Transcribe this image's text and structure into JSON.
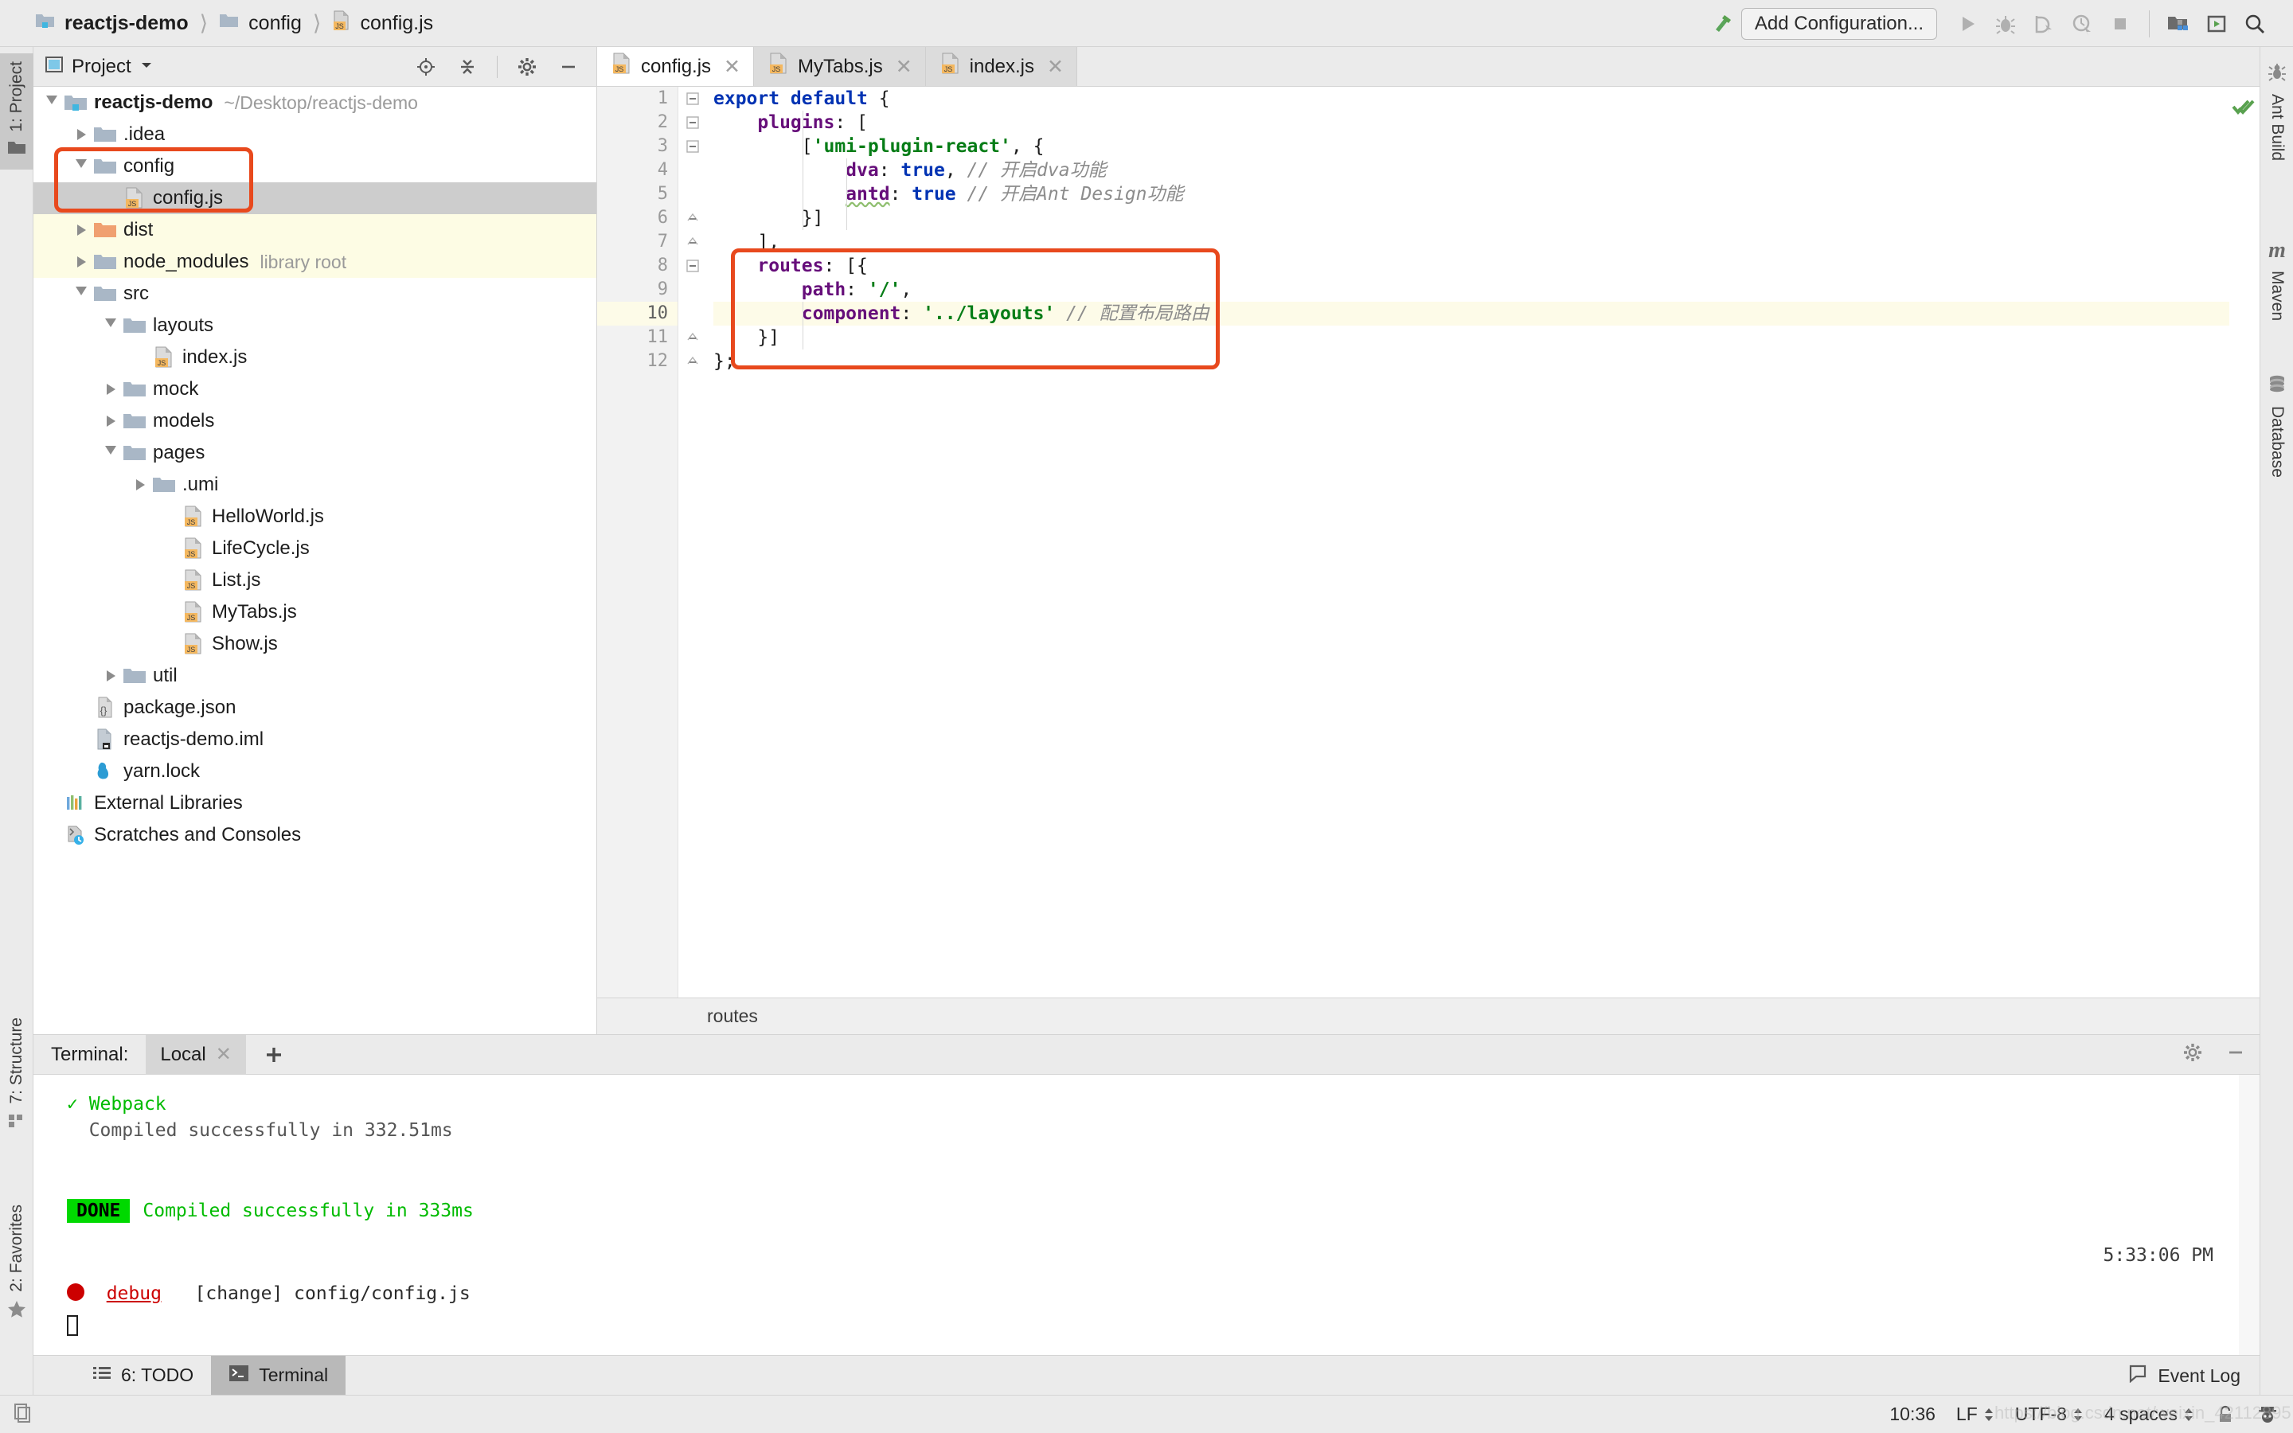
{
  "app": {
    "accent": "#e8491d",
    "breadcrumb": [
      {
        "label": "reactjs-demo",
        "icon": "module-folder-icon"
      },
      {
        "label": "config",
        "icon": "folder-icon"
      },
      {
        "label": "config.js",
        "icon": "js-file-icon"
      }
    ]
  },
  "toolbar": {
    "build_icon": "build-hammer-icon",
    "run_config": "Add Configuration...",
    "run_icon": "run-icon",
    "debug_icon": "debug-bug-icon",
    "coverage_icon": "run-with-coverage-icon",
    "profile_icon": "profiler-icon",
    "stop_icon": "stop-icon",
    "structure_icon": "project-structure-icon",
    "updates_icon": "run-anything-icon",
    "search_icon": "search-everywhere-icon"
  },
  "left_strip": [
    {
      "label": "1: Project",
      "icon": "project-folder-icon",
      "active": true
    },
    {
      "label": "7: Structure",
      "icon": "structure-squares-icon",
      "active": false
    },
    {
      "label": "2: Favorites",
      "icon": "favorites-star-icon",
      "active": false
    }
  ],
  "right_strip": [
    {
      "label": "Ant Build",
      "icon": "ant-icon"
    },
    {
      "label": "Maven",
      "icon": "maven-m-icon"
    },
    {
      "label": "Database",
      "icon": "database-cylinder-icon"
    }
  ],
  "project_panel": {
    "title": "Project",
    "dropdown_icon": "chevron-down-icon",
    "locate_icon": "scroll-from-source-icon",
    "collapse_icon": "collapse-all-icon",
    "settings_icon": "gear-icon",
    "hide_icon": "hide-icon",
    "tree": [
      {
        "label": "reactjs-demo",
        "sub": "~/Desktop/reactjs-demo",
        "depth": 0,
        "twist": "open",
        "icon": "module-folder-icon",
        "bold": true,
        "state": "normal"
      },
      {
        "label": ".idea",
        "sub": "",
        "depth": 1,
        "twist": "closed",
        "icon": "folder-icon",
        "bold": false,
        "state": "normal"
      },
      {
        "label": "config",
        "sub": "",
        "depth": 1,
        "twist": "open",
        "icon": "folder-icon",
        "bold": false,
        "state": "normal"
      },
      {
        "label": "config.js",
        "sub": "",
        "depth": 2,
        "twist": "none",
        "icon": "js-file-icon",
        "bold": false,
        "state": "selected"
      },
      {
        "label": "dist",
        "sub": "",
        "depth": 1,
        "twist": "closed",
        "icon": "excluded-folder-icon",
        "bold": false,
        "state": "yellow"
      },
      {
        "label": "node_modules",
        "sub": "library root",
        "depth": 1,
        "twist": "closed",
        "icon": "folder-icon",
        "bold": false,
        "state": "yellow"
      },
      {
        "label": "src",
        "sub": "",
        "depth": 1,
        "twist": "open",
        "icon": "folder-icon",
        "bold": false,
        "state": "normal"
      },
      {
        "label": "layouts",
        "sub": "",
        "depth": 2,
        "twist": "open",
        "icon": "folder-icon",
        "bold": false,
        "state": "normal"
      },
      {
        "label": "index.js",
        "sub": "",
        "depth": 3,
        "twist": "none",
        "icon": "js-file-icon",
        "bold": false,
        "state": "normal"
      },
      {
        "label": "mock",
        "sub": "",
        "depth": 2,
        "twist": "closed",
        "icon": "folder-icon",
        "bold": false,
        "state": "normal"
      },
      {
        "label": "models",
        "sub": "",
        "depth": 2,
        "twist": "closed",
        "icon": "folder-icon",
        "bold": false,
        "state": "normal"
      },
      {
        "label": "pages",
        "sub": "",
        "depth": 2,
        "twist": "open",
        "icon": "folder-icon",
        "bold": false,
        "state": "normal"
      },
      {
        "label": ".umi",
        "sub": "",
        "depth": 3,
        "twist": "closed",
        "icon": "folder-icon",
        "bold": false,
        "state": "normal"
      },
      {
        "label": "HelloWorld.js",
        "sub": "",
        "depth": 4,
        "twist": "none",
        "icon": "js-file-icon",
        "bold": false,
        "state": "normal"
      },
      {
        "label": "LifeCycle.js",
        "sub": "",
        "depth": 4,
        "twist": "none",
        "icon": "js-file-icon",
        "bold": false,
        "state": "normal"
      },
      {
        "label": "List.js",
        "sub": "",
        "depth": 4,
        "twist": "none",
        "icon": "js-file-icon",
        "bold": false,
        "state": "normal"
      },
      {
        "label": "MyTabs.js",
        "sub": "",
        "depth": 4,
        "twist": "none",
        "icon": "js-file-icon",
        "bold": false,
        "state": "normal"
      },
      {
        "label": "Show.js",
        "sub": "",
        "depth": 4,
        "twist": "none",
        "icon": "js-file-icon",
        "bold": false,
        "state": "normal"
      },
      {
        "label": "util",
        "sub": "",
        "depth": 2,
        "twist": "closed",
        "icon": "folder-icon",
        "bold": false,
        "state": "normal"
      },
      {
        "label": "package.json",
        "sub": "",
        "depth": 1,
        "twist": "none",
        "icon": "json-file-icon",
        "bold": false,
        "state": "normal"
      },
      {
        "label": "reactjs-demo.iml",
        "sub": "",
        "depth": 1,
        "twist": "none",
        "icon": "iml-file-icon",
        "bold": false,
        "state": "normal"
      },
      {
        "label": "yarn.lock",
        "sub": "",
        "depth": 1,
        "twist": "none",
        "icon": "yarn-file-icon",
        "bold": false,
        "state": "normal"
      },
      {
        "label": "External Libraries",
        "sub": "",
        "depth": 0,
        "twist": "none",
        "icon": "external-libraries-icon",
        "bold": false,
        "state": "normal"
      },
      {
        "label": "Scratches and Consoles",
        "sub": "",
        "depth": 0,
        "twist": "none",
        "icon": "scratches-icon",
        "bold": false,
        "state": "normal"
      }
    ]
  },
  "editor": {
    "tabs": [
      {
        "label": "config.js",
        "icon": "js-file-icon",
        "active": true
      },
      {
        "label": "MyTabs.js",
        "icon": "js-file-icon",
        "active": false
      },
      {
        "label": "index.js",
        "icon": "js-file-icon",
        "active": false
      }
    ],
    "breadcrumb": "routes",
    "inspection_icon": "inspections-ok-icon",
    "caret_line": 10,
    "line_numbers": [
      "1",
      "2",
      "3",
      "4",
      "5",
      "6",
      "7",
      "8",
      "9",
      "10",
      "11",
      "12"
    ],
    "lines": [
      {
        "n": 1,
        "tokens": [
          {
            "t": "export default ",
            "c": "kw"
          },
          {
            "t": "{",
            "c": "pl"
          }
        ]
      },
      {
        "n": 2,
        "tokens": [
          {
            "t": "    ",
            "c": "pl"
          },
          {
            "t": "plugins",
            "c": "key"
          },
          {
            "t": ": [",
            "c": "pl"
          }
        ]
      },
      {
        "n": 3,
        "tokens": [
          {
            "t": "        [",
            "c": "pl"
          },
          {
            "t": "'umi-plugin-react'",
            "c": "str"
          },
          {
            "t": ", {",
            "c": "pl"
          }
        ]
      },
      {
        "n": 4,
        "tokens": [
          {
            "t": "            ",
            "c": "pl"
          },
          {
            "t": "dva",
            "c": "key"
          },
          {
            "t": ": ",
            "c": "pl"
          },
          {
            "t": "true",
            "c": "kw"
          },
          {
            "t": ", ",
            "c": "pl"
          },
          {
            "t": "// 开启dva功能",
            "c": "cmt"
          }
        ]
      },
      {
        "n": 5,
        "tokens": [
          {
            "t": "            ",
            "c": "pl"
          },
          {
            "t": "antd",
            "c": "key-spell"
          },
          {
            "t": ": ",
            "c": "pl"
          },
          {
            "t": "true",
            "c": "kw"
          },
          {
            "t": " ",
            "c": "pl"
          },
          {
            "t": "// 开启Ant Design功能",
            "c": "cmt"
          }
        ]
      },
      {
        "n": 6,
        "tokens": [
          {
            "t": "        }]",
            "c": "pl"
          }
        ]
      },
      {
        "n": 7,
        "tokens": [
          {
            "t": "    ],",
            "c": "pl"
          }
        ]
      },
      {
        "n": 8,
        "tokens": [
          {
            "t": "    ",
            "c": "pl"
          },
          {
            "t": "routes",
            "c": "key"
          },
          {
            "t": ": [{",
            "c": "pl"
          }
        ]
      },
      {
        "n": 9,
        "tokens": [
          {
            "t": "        ",
            "c": "pl"
          },
          {
            "t": "path",
            "c": "key"
          },
          {
            "t": ": ",
            "c": "pl"
          },
          {
            "t": "'/'",
            "c": "str"
          },
          {
            "t": ",",
            "c": "pl"
          }
        ]
      },
      {
        "n": 10,
        "tokens": [
          {
            "t": "        ",
            "c": "pl"
          },
          {
            "t": "component",
            "c": "key"
          },
          {
            "t": ": ",
            "c": "pl"
          },
          {
            "t": "'../layouts'",
            "c": "str"
          },
          {
            "t": " ",
            "c": "pl"
          },
          {
            "t": "// 配置布局路由",
            "c": "cmt"
          }
        ]
      },
      {
        "n": 11,
        "tokens": [
          {
            "t": "    }]",
            "c": "pl"
          }
        ]
      },
      {
        "n": 12,
        "tokens": [
          {
            "t": "};",
            "c": "pl"
          }
        ]
      }
    ]
  },
  "terminal": {
    "label": "Terminal:",
    "tab": "Local",
    "close_icon": "close-icon",
    "new_tab_icon": "plus-icon",
    "settings_icon": "gear-icon",
    "hide_icon": "hide-icon",
    "timestamp": "5:33:06 PM",
    "lines": [
      {
        "type": "check",
        "text": "Webpack"
      },
      {
        "type": "gray",
        "text": "  Compiled successfully in 332.51ms"
      },
      {
        "type": "blank",
        "text": ""
      },
      {
        "type": "blank",
        "text": ""
      },
      {
        "type": "done",
        "badge": "DONE",
        "text": "Compiled successfully in 333ms"
      },
      {
        "type": "blank",
        "text": ""
      },
      {
        "type": "blank",
        "text": ""
      },
      {
        "type": "debug",
        "badge": "debug",
        "text": "   [change] config/config.js"
      },
      {
        "type": "caret",
        "text": ""
      }
    ]
  },
  "bottom_tabs": [
    {
      "label": "6: TODO",
      "icon": "todo-list-icon",
      "active": false
    },
    {
      "label": "Terminal",
      "icon": "terminal-icon",
      "active": true
    }
  ],
  "event_log": {
    "label": "Event Log",
    "icon": "event-log-icon"
  },
  "status_bar": {
    "left_icon": "copy-indicator-icon",
    "position": "10:36",
    "line_sep": "LF",
    "encoding": "UTF-8",
    "indent": "4 spaces",
    "lock_icon": "read-write-lock-icon",
    "inspector_icon": "hector-inspection-icon"
  },
  "watermark": "https://blog.csdn.net/weixin_42112895"
}
